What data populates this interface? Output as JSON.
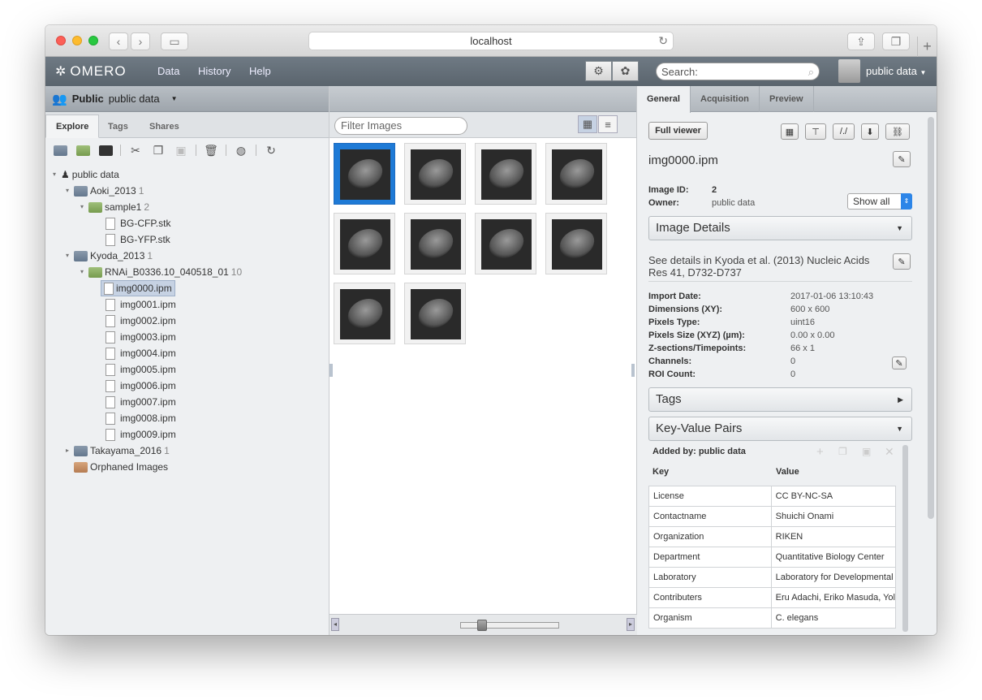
{
  "browser": {
    "url": "localhost"
  },
  "app": {
    "logo": "OMERO",
    "nav": [
      "Data",
      "History",
      "Help"
    ],
    "search_placeholder": "Search:",
    "user": "public data"
  },
  "group": {
    "name": "Public",
    "user": "public data"
  },
  "left_tabs": [
    "Explore",
    "Tags",
    "Shares"
  ],
  "tree": {
    "root": "public data",
    "projects": [
      {
        "name": "Aoki_2013",
        "count": "1",
        "datasets": [
          {
            "name": "sample1",
            "count": "2",
            "images": [
              "BG-CFP.stk",
              "BG-YFP.stk"
            ]
          }
        ]
      },
      {
        "name": "Kyoda_2013",
        "count": "1",
        "datasets": [
          {
            "name": "RNAi_B0336.10_040518_01",
            "count": "10",
            "images": [
              "img0000.ipm",
              "img0001.ipm",
              "img0002.ipm",
              "img0003.ipm",
              "img0004.ipm",
              "img0005.ipm",
              "img0006.ipm",
              "img0007.ipm",
              "img0008.ipm",
              "img0009.ipm"
            ]
          }
        ]
      },
      {
        "name": "Takayama_2016",
        "count": "1",
        "datasets": []
      }
    ],
    "orphaned": "Orphaned Images",
    "selected": "img0000.ipm"
  },
  "center": {
    "filter_placeholder": "Filter Images",
    "thumbnail_count": 10,
    "selected_index": 0
  },
  "right": {
    "tabs": [
      "General",
      "Acquisition",
      "Preview"
    ],
    "full_viewer": "Full viewer",
    "image_name": "img0000.ipm",
    "image_id_label": "Image ID:",
    "image_id": "2",
    "owner_label": "Owner:",
    "owner": "public data",
    "show_all": "Show all",
    "image_details": "Image Details",
    "description": "See details in Kyoda et al. (2013) Nucleic Acids Res 41, D732-D737",
    "details": [
      {
        "label": "Import Date:",
        "value": "2017-01-06 13:10:43"
      },
      {
        "label": "Dimensions (XY):",
        "value": "600 x 600"
      },
      {
        "label": "Pixels Type:",
        "value": "uint16"
      },
      {
        "label": "Pixels Size (XYZ) (µm):",
        "value": "0.00 x 0.00"
      },
      {
        "label": "Z-sections/Timepoints:",
        "value": "66 x 1"
      },
      {
        "label": "Channels:",
        "value": "0"
      },
      {
        "label": "ROI Count:",
        "value": "0"
      }
    ],
    "tags": "Tags",
    "kv_title": "Key-Value Pairs",
    "added_by": "Added by: public data",
    "kv_headers": [
      "Key",
      "Value"
    ],
    "kv_rows": [
      {
        "key": "License",
        "value": "CC BY-NC-SA"
      },
      {
        "key": "Contactname",
        "value": "Shuichi Onami"
      },
      {
        "key": "Organization",
        "value": "RIKEN"
      },
      {
        "key": "Department",
        "value": "Quantitative Biology Center"
      },
      {
        "key": "Laboratory",
        "value": "Laboratory for Developmental"
      },
      {
        "key": "Contributers",
        "value": "Eru Adachi, Eriko Masuda, Yol"
      },
      {
        "key": "Organism",
        "value": "C. elegans"
      }
    ]
  }
}
